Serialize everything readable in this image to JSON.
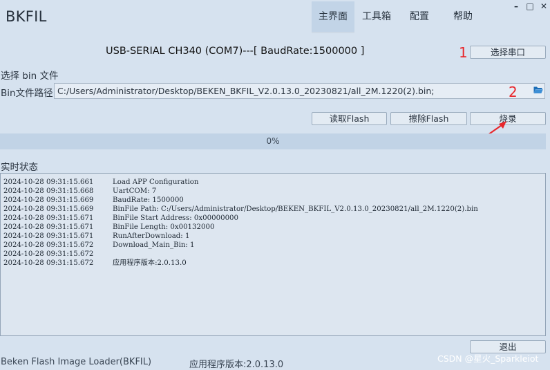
{
  "header": {
    "app_title": "BKFIL",
    "tabs": [
      {
        "label": "主界面",
        "active": true
      },
      {
        "label": "工具箱",
        "active": false
      },
      {
        "label": "配置",
        "active": false
      },
      {
        "label": "帮助",
        "active": false
      }
    ],
    "window_controls": {
      "minimize": "–",
      "maximize": "□",
      "close": "✕"
    }
  },
  "port": {
    "status_text": "USB-SERIAL CH340 (COM7)---[ BaudRate:1500000 ]",
    "select_port_label": "选择串口"
  },
  "file": {
    "section_label": "选择 bin 文件",
    "path_label": "Bin文件路径",
    "path_value": "C:/Users/Administrator/Desktop/BEKEN_BKFIL_V2.0.13.0_20230821/all_2M.1220(2).bin;"
  },
  "actions": {
    "read_flash_label": "读取Flash",
    "erase_flash_label": "擦除Flash",
    "burn_label": "烧录"
  },
  "progress": {
    "value": 0,
    "text": "0%"
  },
  "log": {
    "section_label": "实时状态",
    "lines": [
      {
        "ts": "2024-10-28 09:31:15.661",
        "msg": "Load APP Configuration"
      },
      {
        "ts": "2024-10-28 09:31:15.668",
        "msg": "UartCOM: 7"
      },
      {
        "ts": "2024-10-28 09:31:15.669",
        "msg": "BaudRate: 1500000"
      },
      {
        "ts": "2024-10-28 09:31:15.669",
        "msg": "BinFile Path: C:/Users/Administrator/Desktop/BEKEN_BKFIL_V2.0.13.0_20230821/all_2M.1220(2).bin"
      },
      {
        "ts": "2024-10-28 09:31:15.671",
        "msg": "BinFile Start Address: 0x00000000"
      },
      {
        "ts": "2024-10-28 09:31:15.671",
        "msg": "BinFile Length: 0x00132000"
      },
      {
        "ts": "2024-10-28 09:31:15.671",
        "msg": "RunAfterDownload: 1"
      },
      {
        "ts": "2024-10-28 09:31:15.672",
        "msg": "Download_Main_Bin: 1"
      },
      {
        "ts": "2024-10-28 09:31:15.672",
        "msg": ""
      },
      {
        "ts": "2024-10-28 09:31:15.672",
        "msg": "应用程序版本:2.0.13.0"
      }
    ]
  },
  "bottom": {
    "exit_label": "退出",
    "app_name": "Beken Flash Image Loader(BKFIL)",
    "version": "应用程序版本:2.0.13.0"
  },
  "annotations": {
    "marker_1": "1",
    "marker_2": "2",
    "arrow_color": "#e8262b"
  },
  "watermark": "CSDN @星火_Sparkleiot",
  "colors": {
    "background": "#d6e2ef",
    "active_tab": "#c2d4e7",
    "progress_track": "#c1d3e6",
    "annotation_red": "#e8262b"
  },
  "icons": {
    "folder": "folder-open-icon"
  }
}
